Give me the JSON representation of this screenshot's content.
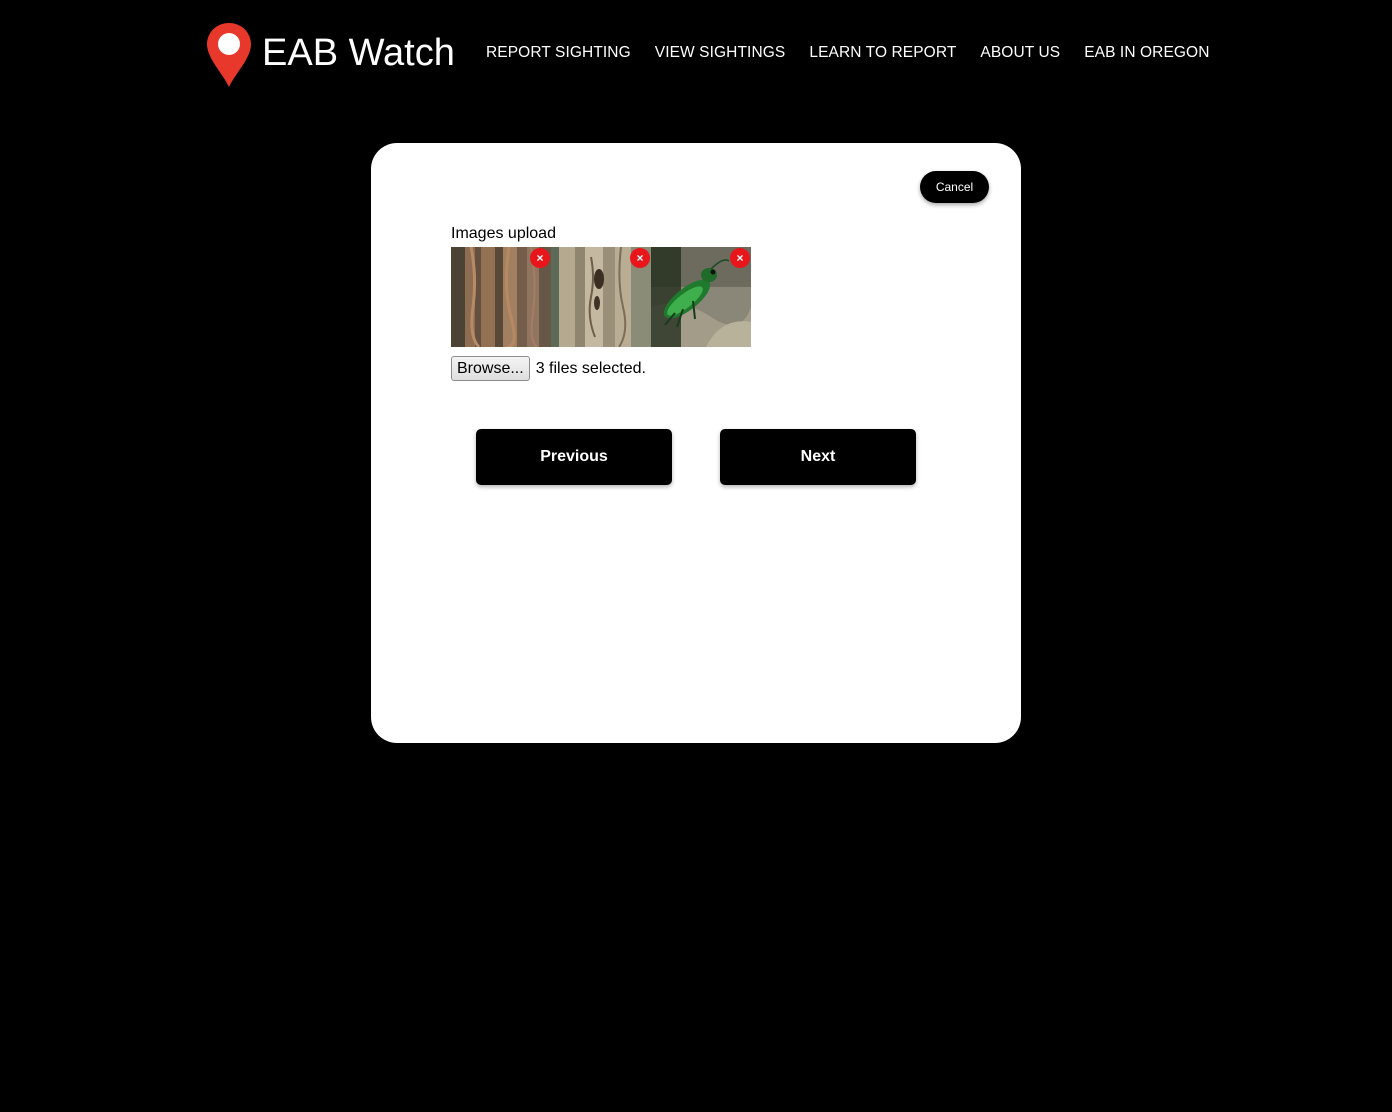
{
  "header": {
    "logo_text": "EAB Watch",
    "logo_icon": "map-pin-icon",
    "brand_color": "#e8382b",
    "nav": [
      {
        "label": "REPORT SIGHTING"
      },
      {
        "label": "VIEW SIGHTINGS"
      },
      {
        "label": "LEARN TO REPORT"
      },
      {
        "label": "ABOUT US"
      },
      {
        "label": "EAB IN OREGON"
      }
    ]
  },
  "form": {
    "cancel_label": "Cancel",
    "upload_label": "Images upload",
    "thumbnails": [
      {
        "name": "bark-gallery-image",
        "remove_icon": "close-icon"
      },
      {
        "name": "bark-exit-hole-image",
        "remove_icon": "close-icon"
      },
      {
        "name": "green-beetle-image",
        "remove_icon": "close-icon"
      }
    ],
    "remove_symbol": "×",
    "remove_color": "#e8161b",
    "browse_label": "Browse...",
    "file_status": "3 files selected.",
    "previous_label": "Previous",
    "next_label": "Next"
  }
}
